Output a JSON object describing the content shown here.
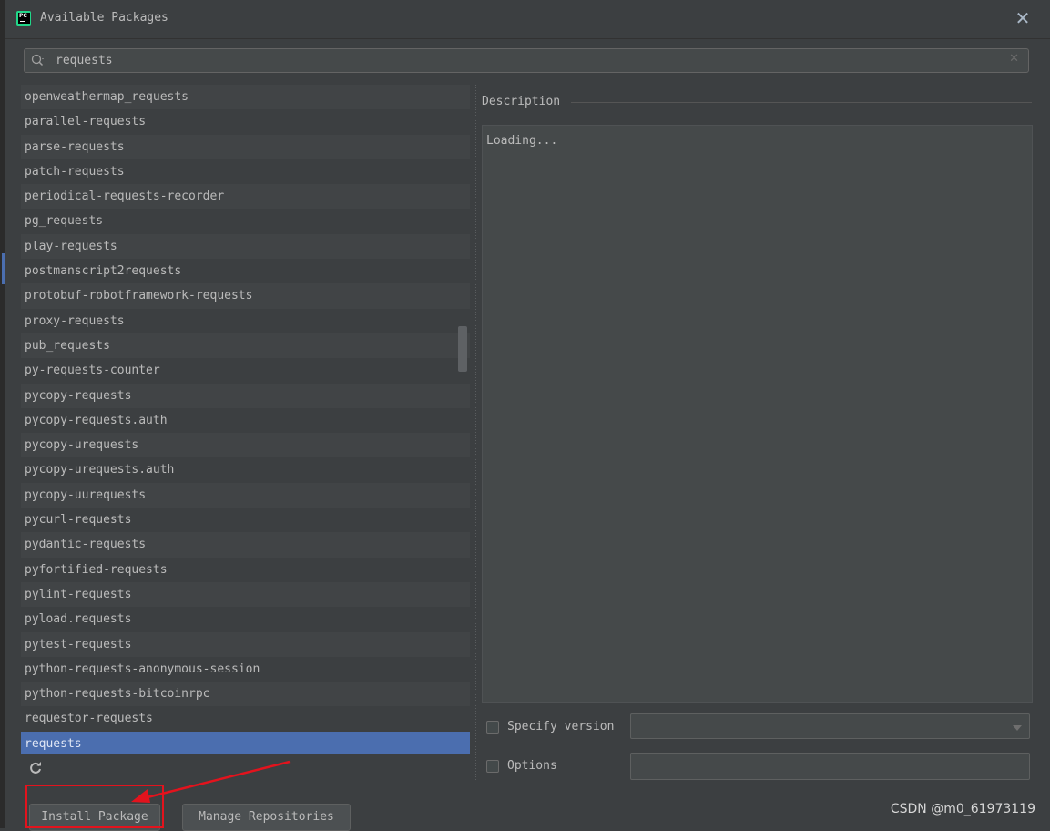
{
  "window": {
    "title": "Available Packages",
    "app_icon_text": "PC",
    "close_glyph": "✕"
  },
  "search": {
    "value": "requests",
    "clear_glyph": "✕"
  },
  "packages": {
    "items": [
      "openweathermap_requests",
      "parallel-requests",
      "parse-requests",
      "patch-requests",
      "periodical-requests-recorder",
      "pg_requests",
      "play-requests",
      "postmanscript2requests",
      "protobuf-robotframework-requests",
      "proxy-requests",
      "pub_requests",
      "py-requests-counter",
      "pycopy-requests",
      "pycopy-requests.auth",
      "pycopy-urequests",
      "pycopy-urequests.auth",
      "pycopy-uurequests",
      "pycurl-requests",
      "pydantic-requests",
      "pyfortified-requests",
      "pylint-requests",
      "pyload.requests",
      "pytest-requests",
      "python-requests-anonymous-session",
      "python-requests-bitcoinrpc",
      "requestor-requests",
      "requests"
    ],
    "selected": "requests"
  },
  "description": {
    "label": "Description",
    "text": "Loading..."
  },
  "options": {
    "specify_version_label": "Specify version",
    "specify_version_checked": false,
    "version_value": "",
    "options_label": "Options",
    "options_checked": false,
    "options_value": ""
  },
  "buttons": {
    "install": "Install Package",
    "manage": "Manage Repositories"
  },
  "watermark": "CSDN @m0_61973119",
  "colors": {
    "background": "#3c3f41",
    "selection": "#4b6eaf",
    "annotation": "#e3131d"
  },
  "icons": {
    "search": "search-icon",
    "refresh": "refresh-icon",
    "close": "close-icon",
    "dropdown": "chevron-down-icon"
  }
}
